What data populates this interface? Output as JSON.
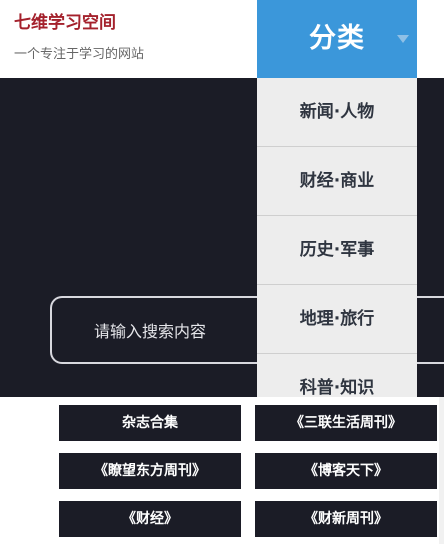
{
  "header": {
    "site_title": "七维学习空间",
    "site_subtitle": "一个专注于学习的网站",
    "category_label": "分类"
  },
  "menu": {
    "items": [
      "新闻·人物",
      "财经·商业",
      "历史·军事",
      "地理·旅行",
      "科普·知识"
    ]
  },
  "search": {
    "placeholder": "请输入搜索内容",
    "value": ""
  },
  "tags": [
    "杂志合集",
    "《三联生活周刊》",
    "《瞭望东方周刊》",
    "《博客天下》",
    "《财经》",
    "《财新周刊》"
  ],
  "colors": {
    "brand_red": "#a4212c",
    "accent_blue": "#3b97da",
    "dark_bg": "#1b1c26",
    "menu_bg": "#ededed"
  }
}
